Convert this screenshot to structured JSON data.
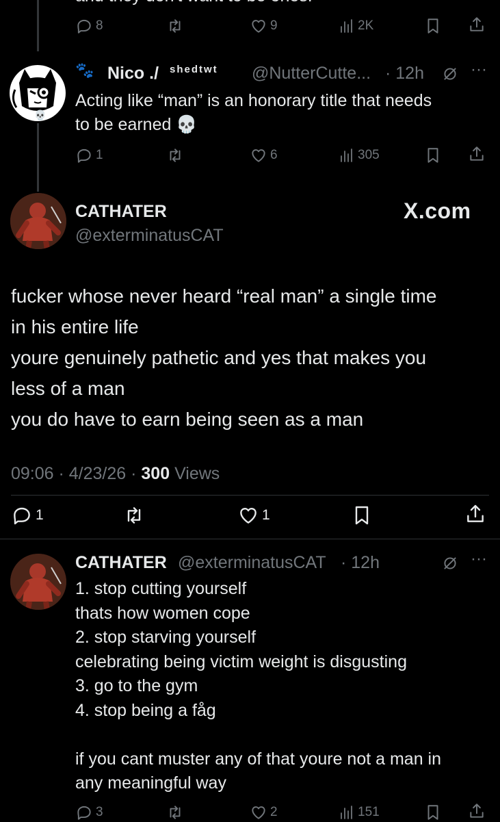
{
  "top_tweet": {
    "cut_text": "and they don't want to be ones.",
    "replies": "8",
    "likes": "9",
    "views": "2K"
  },
  "reply1": {
    "name": "Nico ./",
    "name_superscript": "shedtwt",
    "handle": "@NutterCutte...",
    "time": "· 12h",
    "text": "Acting like “man” is an honorary title that needs\nto be earned 💀",
    "replies": "1",
    "likes": "6",
    "views": "305"
  },
  "main": {
    "name": "CATHATER",
    "handle": "@exterminatusCAT",
    "watermark": "X.com",
    "text": "fucker whose never heard “real man” a single time\nin his entire life\nyoure genuinely pathetic and yes that makes you\nless of a man\nyou do have to earn being seen as a man",
    "meta_time": "09:06 · 4/23/26 · ",
    "views_count": "300",
    "views_label": " Views",
    "replies": "1",
    "likes": "1"
  },
  "reply2": {
    "name": "CATHATER",
    "handle": "@exterminatusCAT",
    "time": "· 12h",
    "text": "1. stop cutting yourself\nthats how women cope\n2. stop starving yourself\ncelebrating being victim weight is disgusting\n3. go to the gym\n4. stop being a fåg\n\nif you cant muster any of that youre not a man in\nany meaningful way",
    "replies": "3",
    "likes": "2",
    "views": "151"
  },
  "icons": {
    "reply": "reply-icon",
    "retweet": "retweet-icon",
    "like": "heart-icon",
    "views": "views-icon",
    "bookmark": "bookmark-icon",
    "share": "share-icon",
    "grok": "grok-icon",
    "more": "more-icon"
  },
  "colors": {
    "background": "#000000",
    "text": "#e7e9ea",
    "muted": "#71767b",
    "divider": "#2f3336"
  }
}
